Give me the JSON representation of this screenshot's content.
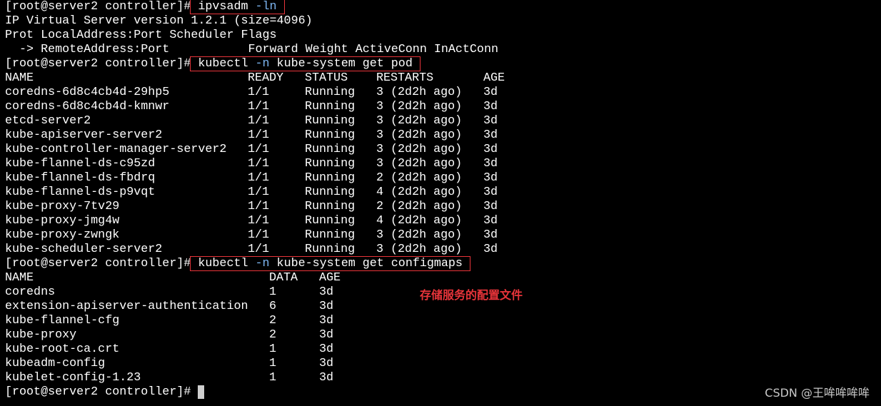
{
  "terminal": {
    "prompt": "[root@server2 controller]#",
    "cmd1": {
      "pre": "ipvsadm ",
      "flag": "-ln",
      "post": "",
      "output": [
        "IP Virtual Server version 1.2.1 (size=4096)",
        "Prot LocalAddress:Port Scheduler Flags",
        "  -> RemoteAddress:Port           Forward Weight ActiveConn InActConn"
      ]
    },
    "cmd2": {
      "pre": "kubectl ",
      "flag": "-n",
      "post": " kube-system get pod",
      "headers": [
        "NAME",
        "READY",
        "STATUS",
        "RESTARTS",
        "AGE"
      ],
      "rows": [
        [
          "coredns-6d8c4cb4d-29hp5",
          "1/1",
          "Running",
          "3 (2d2h ago)",
          "3d"
        ],
        [
          "coredns-6d8c4cb4d-kmnwr",
          "1/1",
          "Running",
          "3 (2d2h ago)",
          "3d"
        ],
        [
          "etcd-server2",
          "1/1",
          "Running",
          "3 (2d2h ago)",
          "3d"
        ],
        [
          "kube-apiserver-server2",
          "1/1",
          "Running",
          "3 (2d2h ago)",
          "3d"
        ],
        [
          "kube-controller-manager-server2",
          "1/1",
          "Running",
          "3 (2d2h ago)",
          "3d"
        ],
        [
          "kube-flannel-ds-c95zd",
          "1/1",
          "Running",
          "3 (2d2h ago)",
          "3d"
        ],
        [
          "kube-flannel-ds-fbdrq",
          "1/1",
          "Running",
          "2 (2d2h ago)",
          "3d"
        ],
        [
          "kube-flannel-ds-p9vqt",
          "1/1",
          "Running",
          "4 (2d2h ago)",
          "3d"
        ],
        [
          "kube-proxy-7tv29",
          "1/1",
          "Running",
          "2 (2d2h ago)",
          "3d"
        ],
        [
          "kube-proxy-jmg4w",
          "1/1",
          "Running",
          "4 (2d2h ago)",
          "3d"
        ],
        [
          "kube-proxy-zwngk",
          "1/1",
          "Running",
          "3 (2d2h ago)",
          "3d"
        ],
        [
          "kube-scheduler-server2",
          "1/1",
          "Running",
          "3 (2d2h ago)",
          "3d"
        ]
      ]
    },
    "cmd3": {
      "pre": "kubectl ",
      "flag": "-n",
      "post": " kube-system get configmaps",
      "headers": [
        "NAME",
        "DATA",
        "AGE"
      ],
      "rows": [
        [
          "coredns",
          "1",
          "3d"
        ],
        [
          "extension-apiserver-authentication",
          "6",
          "3d"
        ],
        [
          "kube-flannel-cfg",
          "2",
          "3d"
        ],
        [
          "kube-proxy",
          "2",
          "3d"
        ],
        [
          "kube-root-ca.crt",
          "1",
          "3d"
        ],
        [
          "kubeadm-config",
          "1",
          "3d"
        ],
        [
          "kubelet-config-1.23",
          "1",
          "3d"
        ]
      ]
    }
  },
  "annotation": "存储服务的配置文件",
  "watermark": "CSDN @王哞哞哞哞",
  "colors": {
    "background": "#000000",
    "text": "#ffffff",
    "flag": "#7db6f2",
    "highlight_box": "#e8343a"
  }
}
